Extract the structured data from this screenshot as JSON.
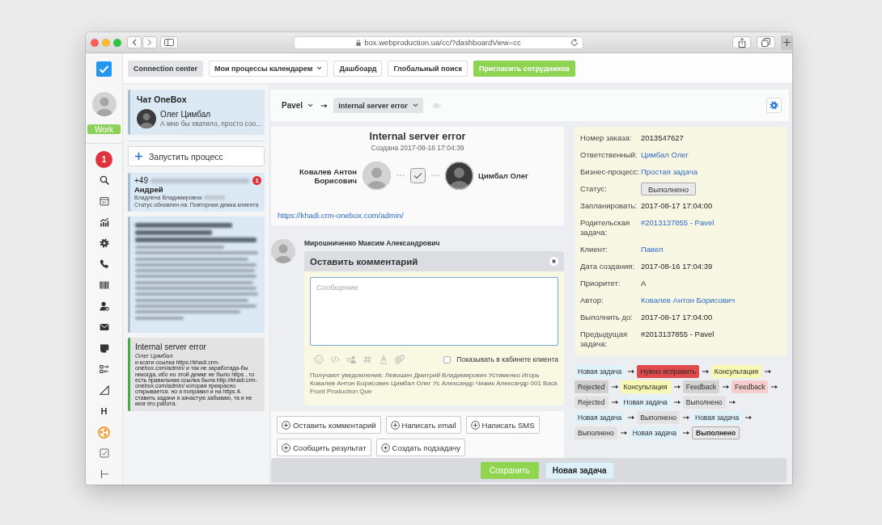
{
  "browser": {
    "url": "box.webproduction.ua/cc/?dashboardView=cc"
  },
  "toolbar": {
    "buttons": [
      {
        "label": "Connection center",
        "kind": "tab",
        "selected": true
      },
      {
        "label": "Мои процессы календарем",
        "kind": "dropdown",
        "selected": false
      },
      {
        "label": "Дашбоард",
        "kind": "tab",
        "selected": false
      },
      {
        "label": "Глобальный поиск",
        "kind": "tab",
        "selected": false
      },
      {
        "label": "Пригласить сотрудников",
        "kind": "primary",
        "selected": false
      }
    ]
  },
  "nav": {
    "status_button": "Work",
    "notification_count": "1",
    "letter_icon": "H"
  },
  "chat_panel": {
    "chat": {
      "title": "Чат OneBox",
      "name": "Олег Цимбал",
      "preview": "А мне бы хватило, просто соо..."
    },
    "start_button": "Запустить процесс",
    "cards": [
      {
        "kind": "lead",
        "selected": false,
        "phone": "+49",
        "badge": "1",
        "name": "Андрей",
        "manager": "Владлена Владимировна",
        "status": "Статус обновлен на: Повторная демка клиента"
      },
      {
        "kind": "blurred",
        "selected": false
      },
      {
        "kind": "message",
        "selected": true,
        "title": "Internal server error",
        "author": "Олег Цимбал",
        "text": "и ксати ссылка https://khadi.crm-onebox.com/admin/ и так не заработада-бы никогда, ибо но этой демке не было https , то есть правильная ссылка была http://khadi.crm-onebox.com/admin/ которая прекрасно открывается. но я поправил и на https А ставить задачи я зачастую забываю, та и не моя это работа."
      }
    ]
  },
  "breadcrumb": {
    "owner": "Pavel",
    "process": "Internal server error"
  },
  "task": {
    "title": "Internal server error",
    "created": "Создана 2017-08-16 17:04:39",
    "author": "Ковалев Антон Борисович",
    "assignee": "Цимбал Олег",
    "link": "https://khadi.crm-onebox.com/admin/"
  },
  "comment_form": {
    "user": "Мирошниченко Максим Александрович",
    "title": "Оставить комментарий",
    "placeholder": "Сообщение",
    "show_to_client": {
      "label": "Показывать в кабинете клиента",
      "checked": false
    },
    "recipients": "Получают уведомления: Левошич Дмитрий Владимирович Устименко Игорь Ковалев Антон Борисович Цимбал Олег Ус Александр Чижик Александр 001 Back Front Production Que"
  },
  "actions": [
    "Оставить комментарий",
    "Написать email",
    "Написать SMS",
    "Сообщить результат",
    "Создать подзадачу"
  ],
  "details": [
    {
      "label": "Номер заказа:",
      "value": "2013547627",
      "kind": "text"
    },
    {
      "label": "Ответственный:",
      "value": "Цимбал Олег",
      "kind": "link"
    },
    {
      "label": "Бизнес-процесс:",
      "value": "Простая задача",
      "kind": "link"
    },
    {
      "label": "Статус:",
      "value": "Выполнено",
      "kind": "button"
    },
    {
      "label": "Запланировать:",
      "value": "2017-08-17 17:04:00",
      "kind": "text"
    },
    {
      "label": "Родительская задача:",
      "value": "#2013137855 - Pavel",
      "kind": "link"
    },
    {
      "label": "Клиент:",
      "value": "Павел",
      "kind": "link"
    },
    {
      "label": "Дата создания:",
      "value": "2017-08-16 17:04:39",
      "kind": "text"
    },
    {
      "label": "Приоритет:",
      "value": "A",
      "kind": "text"
    },
    {
      "label": "Автор:",
      "value": "Ковалев Антон Борисович",
      "kind": "link"
    },
    {
      "label": "Выполнить до:",
      "value": "2017-08-17 17:04:00",
      "kind": "text"
    },
    {
      "label": "Предыдущая задача:",
      "value": "#2013137855 - Pavel",
      "kind": "text"
    }
  ],
  "status_history": [
    {
      "label": "Новая задача",
      "color": "#dff1f9",
      "current": false
    },
    {
      "label": "Нужно исправить",
      "color": "#e04a4a",
      "current": false
    },
    {
      "label": "Консультация",
      "color": "#f8f8b4",
      "current": false
    },
    {
      "label": "Rejected",
      "color": "#cfcfcf",
      "current": false
    },
    {
      "label": "Консультация",
      "color": "#f8f8b4",
      "current": false
    },
    {
      "label": "Feedback",
      "color": "#d3d3d3",
      "current": false
    },
    {
      "label": "Feedback",
      "color": "#f6cccc",
      "current": false
    },
    {
      "label": "Rejected",
      "color": "#e2e2e2",
      "current": false
    },
    {
      "label": "Новая задача",
      "color": "#dff1f9",
      "current": false
    },
    {
      "label": "Выполнено",
      "color": "#e2e2e2",
      "current": false
    },
    {
      "label": "Новая задача",
      "color": "#dff1f9",
      "current": false
    },
    {
      "label": "Выполнено",
      "color": "#e2e2e2",
      "current": false
    },
    {
      "label": "Новая задача",
      "color": "#dff1f9",
      "current": false
    },
    {
      "label": "Выполнено",
      "color": "#e2e2e2",
      "current": false
    },
    {
      "label": "Новая задача",
      "color": "#dff1f9",
      "current": false
    },
    {
      "label": "Выполнено",
      "color": "#e8e8e8",
      "current": true
    }
  ],
  "footer": {
    "buttons": [
      {
        "label": "Сохранить",
        "kind": "primary"
      },
      {
        "label": "Новая задача",
        "kind": "secondary"
      }
    ]
  }
}
